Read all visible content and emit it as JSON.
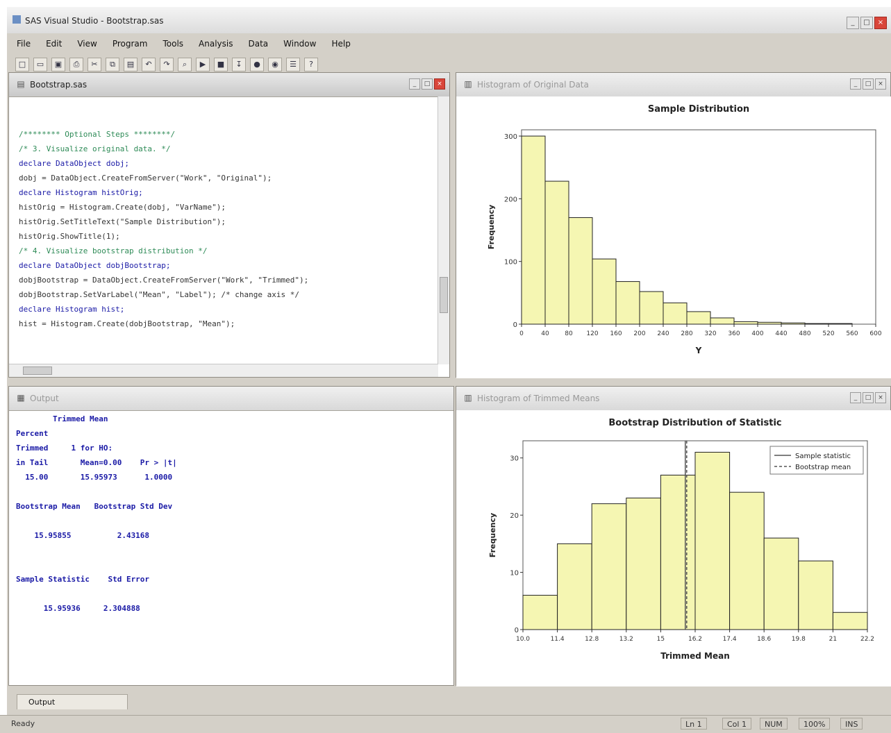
{
  "window": {
    "title": "SAS Visual Studio - Bootstrap.sas",
    "controls": [
      "_",
      "□",
      "×"
    ]
  },
  "menu": [
    "File",
    "Edit",
    "View",
    "Program",
    "Tools",
    "Analysis",
    "Data",
    "Window",
    "Help"
  ],
  "toolbar_icons": [
    "new-icon",
    "open-icon",
    "save-icon",
    "print-icon",
    "cut-icon",
    "copy-icon",
    "paste-icon",
    "undo-icon",
    "redo-icon",
    "find-icon",
    "run-icon",
    "stop-icon",
    "step-icon",
    "break-icon",
    "watch-icon",
    "options-icon",
    "help-icon"
  ],
  "editor": {
    "title": "Bootstrap.sas",
    "lines": [
      {
        "cls": "c-com",
        "text": "/******** Optional Steps ********/"
      },
      {
        "cls": "c-com",
        "text": "/* 3. Visualize original data. */"
      },
      {
        "cls": "c-kw",
        "text": "declare DataObject dobj;"
      },
      {
        "cls": "c-txt",
        "text": "dobj = DataObject.CreateFromServer(\"Work\", \"Original\");"
      },
      {
        "cls": "c-kw",
        "text": "declare Histogram histOrig;"
      },
      {
        "cls": "c-txt",
        "text": "histOrig = Histogram.Create(dobj, \"VarName\");"
      },
      {
        "cls": "c-txt",
        "text": "histOrig.SetTitleText(\"Sample Distribution\");"
      },
      {
        "cls": "c-txt",
        "text": "histOrig.ShowTitle(1);"
      },
      {
        "cls": "c-txt",
        "text": ""
      },
      {
        "cls": "c-com",
        "text": "/* 4. Visualize bootstrap distribution */"
      },
      {
        "cls": "c-kw",
        "text": "declare DataObject dobjBootstrap;"
      },
      {
        "cls": "c-txt",
        "text": "dobjBootstrap = DataObject.CreateFromServer(\"Work\", \"Trimmed\");"
      },
      {
        "cls": "c-txt",
        "text": "dobjBootstrap.SetVarLabel(\"Mean\", \"Label\"); /* change axis */"
      },
      {
        "cls": "c-txt",
        "text": ""
      },
      {
        "cls": "c-kw",
        "text": "declare Histogram hist;"
      },
      {
        "cls": "c-txt",
        "text": "hist = Histogram.Create(dobjBootstrap, \"Mean\");"
      }
    ]
  },
  "output": {
    "title": "Output",
    "lines": [
      "        Trimmed Mean",
      "Percent",
      "Trimmed     1 for HO:",
      "in Tail       Mean=0.00    Pr > |t|",
      "  15.00       15.95973      1.0000",
      "",
      "Bootstrap Mean   Bootstrap Std Dev",
      "",
      "    15.95855          2.43168",
      "",
      "",
      "Sample Statistic    Std Error",
      "",
      "      15.95936     2.304888"
    ]
  },
  "chart1_panel": {
    "title": "Histogram of Original Data"
  },
  "chart2_panel": {
    "title": "Histogram of Trimmed Means"
  },
  "chart_data": [
    {
      "type": "bar",
      "title": "Sample Distribution",
      "xlabel": "Y",
      "ylabel": "Frequency",
      "categories": [
        "0",
        "40",
        "80",
        "120",
        "160",
        "200",
        "240",
        "280",
        "320",
        "360",
        "400",
        "440",
        "480",
        "520",
        "560",
        "600"
      ],
      "values": [
        300,
        228,
        170,
        104,
        68,
        52,
        34,
        20,
        10,
        4,
        3,
        2,
        1,
        1,
        0
      ],
      "ylim": [
        0,
        310
      ],
      "yticks": [
        "0",
        "100",
        "200",
        "300"
      ],
      "colors": {
        "bar": "#f5f6b2",
        "bar_edge": "#222"
      }
    },
    {
      "type": "bar",
      "title": "Bootstrap Distribution of Statistic",
      "xlabel": "Trimmed Mean",
      "ylabel": "Frequency",
      "xticks": [
        "10.0",
        "11.4",
        "12.8",
        "13.2",
        "15",
        "16.2",
        "17.4",
        "18.6",
        "19.8",
        "21",
        "22.2"
      ],
      "values": [
        6,
        15,
        22,
        23,
        27,
        31,
        24,
        16,
        12,
        3
      ],
      "ylim": [
        0,
        33
      ],
      "yticks": [
        "0",
        "10",
        "20",
        "30"
      ],
      "reference_lines": [
        {
          "name": "Sample statistic",
          "x": 15.75,
          "style": "solid"
        },
        {
          "name": "Bootstrap mean",
          "x": 15.8,
          "style": "dashed"
        }
      ],
      "legend": "top-right",
      "colors": {
        "bar": "#f5f6b2",
        "bar_edge": "#222"
      }
    }
  ],
  "tabs": {
    "output_label": "Output"
  },
  "status": {
    "left": "Ready",
    "ln": "Ln 1",
    "col": "Col 1",
    "mode": "NUM",
    "zoom": "100%",
    "insert": "INS"
  }
}
